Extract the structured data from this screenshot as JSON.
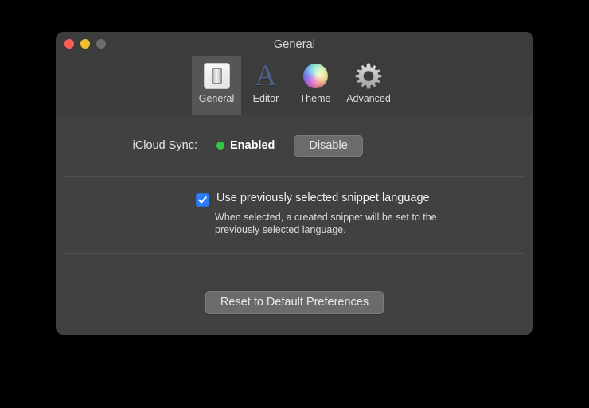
{
  "window": {
    "title": "General",
    "traffic_lights": [
      {
        "name": "close",
        "color": "#ff5f57"
      },
      {
        "name": "minimize",
        "color": "#f0bf2f"
      },
      {
        "name": "zoom",
        "color": "#6d6d6d"
      }
    ]
  },
  "toolbar": {
    "items": [
      {
        "label": "General",
        "icon": "light-switch-icon",
        "selected": true
      },
      {
        "label": "Editor",
        "icon": "serif-letter-a-icon",
        "selected": false
      },
      {
        "label": "Theme",
        "icon": "color-wheel-icon",
        "selected": false
      },
      {
        "label": "Advanced",
        "icon": "gear-icon",
        "selected": false
      }
    ]
  },
  "icloud": {
    "label": "iCloud Sync:",
    "status_text": "Enabled",
    "status_color": "#34c648",
    "button_label": "Disable"
  },
  "snippet_language": {
    "checkbox_label": "Use previously selected snippet language",
    "checked": true,
    "help_text": "When selected, a created snippet will be set to the previously selected language."
  },
  "reset": {
    "button_label": "Reset to Default Preferences"
  },
  "colors": {
    "window_background": "#414141",
    "titlebar_background": "#3c3c3c",
    "accent_checkbox": "#2f7cf6",
    "button_background": "#6b6b6b",
    "separator": "#525252"
  }
}
